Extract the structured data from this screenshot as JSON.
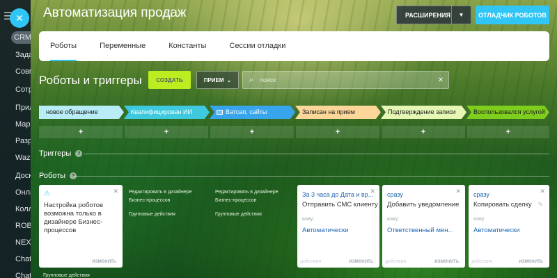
{
  "header": {
    "title": "Автоматизация продаж",
    "extensions_label": "РАСШИРЕНИЯ",
    "debugger_label": "ОТЛАДЧИК РОБОТОВ"
  },
  "sidebar": {
    "items": [
      "CRM",
      "Зада",
      "Совм",
      "Сотр",
      "Прил",
      "Мар",
      "Разр",
      "Wazz",
      "Доск",
      "Онла",
      "Колл",
      "ROBO",
      "NEXT",
      "Chat",
      "Chat"
    ]
  },
  "tabs": [
    "Роботы",
    "Переменные",
    "Константы",
    "Сессии отладки"
  ],
  "toolbar": {
    "section_title": "Роботы и триггеры",
    "create_label": "СОЗДАТЬ",
    "preset_label": "ПРИЕМ",
    "search_placeholder": "поиск"
  },
  "stages": [
    {
      "label": "новое обращение",
      "color": "#b8ecf6"
    },
    {
      "label": "Квалифицирован ИИ",
      "color": "#3ec9de"
    },
    {
      "label": "Ватсап, сайты",
      "color": "#37a4ec"
    },
    {
      "label": "Записан на прием",
      "color": "#fdd79a"
    },
    {
      "label": "Подтверждение записи",
      "color": "#e6f7b5"
    },
    {
      "label": "Воспользовался услугой",
      "color": "#7fce1e"
    }
  ],
  "add_symbol": "+",
  "sections": {
    "triggers": "Триггеры",
    "robots": "Роботы"
  },
  "warning_card": {
    "message": "Настройка роботов возможна только в дизайнере Бизнес-процессов",
    "edit": "изменить"
  },
  "designer_columns": [
    {
      "line1": "Редактировать в дизайнере",
      "line2": "Бизнес-процессов",
      "line3": "Групповые действия"
    },
    {
      "line1": "Редактировать в дизайнере",
      "line2": "Бизнес-процессов",
      "line3": "Групповые действия"
    }
  ],
  "robot_cards": [
    {
      "delay": "За 3 часа до Дата и вр...",
      "name": "Отправить СМС клиенту",
      "whom_label": "кому:",
      "value": "Автоматически",
      "actions": "действия",
      "edit": "изменить"
    },
    {
      "delay": "сразу",
      "name": "Добавить уведомление",
      "whom_label": "кому:",
      "value": "Ответственный мен...",
      "actions": "действия",
      "edit": "изменить"
    },
    {
      "delay": "сразу",
      "name": "Копировать сделку",
      "whom_label": "кому:",
      "value": "Автоматически",
      "actions": "действия",
      "edit": "изменить"
    }
  ],
  "bottom_text": "Групповые действия"
}
